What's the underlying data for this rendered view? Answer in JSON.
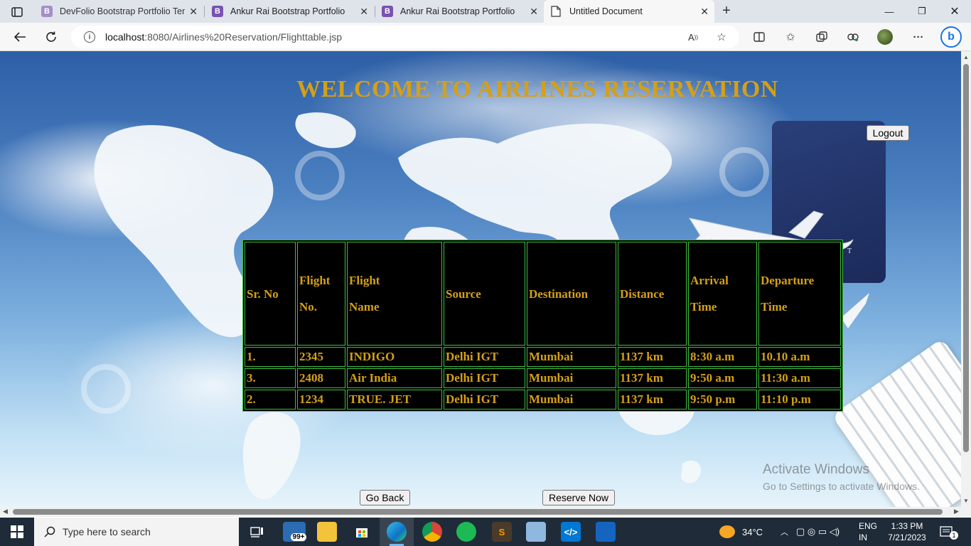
{
  "browser": {
    "tabs": [
      {
        "label": "DevFolio Bootstrap Portfolio Template",
        "favicon": "B"
      },
      {
        "label": "Ankur Rai Bootstrap Portfolio",
        "favicon": "B"
      },
      {
        "label": "Ankur Rai Bootstrap Portfolio",
        "favicon": "B"
      },
      {
        "label": "Untitled Document",
        "favicon": "page"
      }
    ],
    "url_host": "localhost",
    "url_rest": ":8080/Airlines%20Reservation/Flighttable.jsp"
  },
  "page": {
    "heading": "WELCOME TO AIRLINES RESERVATION",
    "logout_label": "Logout",
    "go_back_label": "Go Back",
    "reserve_label": "Reserve Now",
    "passport_text": "T",
    "table": {
      "headers": [
        [
          "Sr. No",
          ""
        ],
        [
          "Flight",
          "No."
        ],
        [
          "Flight",
          "Name"
        ],
        [
          "Source",
          ""
        ],
        [
          "Destination",
          ""
        ],
        [
          "Distance",
          ""
        ],
        [
          "Arrival",
          "Time"
        ],
        [
          "Departure",
          "Time"
        ]
      ],
      "rows": [
        [
          "1.",
          "2345",
          "INDIGO",
          "Delhi IGT",
          "Mumbai",
          "1137 km",
          "8:30 a.m",
          "10.10 a.m"
        ],
        [
          "3.",
          "2408",
          "Air India",
          "Delhi IGT",
          "Mumbai",
          "1137 km",
          "9:50 a.m",
          "11:30 a.m"
        ],
        [
          "2.",
          "1234",
          "TRUE. JET",
          "Delhi IGT",
          "Mumbai",
          "1137 km",
          "9:50 p.m",
          "11:10 p.m"
        ]
      ]
    },
    "activate_title": "Activate Windows",
    "activate_sub": "Go to Settings to activate Windows."
  },
  "taskbar": {
    "search_placeholder": "Type here to search",
    "mail_badge": "99+",
    "weather": "34°C",
    "lang_top": "ENG",
    "lang_bottom": "IN",
    "time": "1:33 PM",
    "date": "7/21/2023",
    "notification_count": "1"
  },
  "colors": {
    "heading": "#d4a017",
    "table_border": "#3fbf3f",
    "table_bg": "#000000",
    "taskbar": "#1f2b38"
  }
}
